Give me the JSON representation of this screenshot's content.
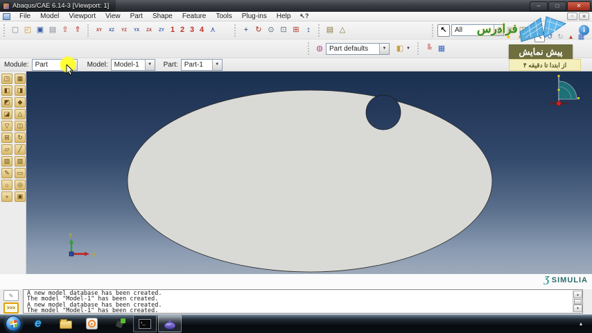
{
  "window": {
    "title": "Abaqus/CAE 6.14-3 [Viewport: 1]",
    "controls": {
      "minimize": "–",
      "maximize": "□",
      "close": "✕"
    },
    "child_controls": {
      "restore": "▫",
      "close": "✕"
    }
  },
  "menubar": {
    "items": [
      "File",
      "Model",
      "Viewport",
      "View",
      "Part",
      "Shape",
      "Feature",
      "Tools",
      "Plug-ins",
      "Help"
    ],
    "context_help": "↖?"
  },
  "toolbar_file": [
    {
      "name": "new-model-icon",
      "g": "▢",
      "tc": "#7a8694"
    },
    {
      "name": "open-database-icon",
      "g": "◰",
      "tc": "#c89020"
    },
    {
      "name": "save-database-icon",
      "g": "▣",
      "tc": "#31589e"
    },
    {
      "name": "print-icon",
      "g": "▤",
      "tc": "#7d8794"
    },
    {
      "name": "import-file-icon",
      "g": "⇧",
      "tc": "#b42d22"
    },
    {
      "name": "export-file-icon",
      "g": "⇑",
      "tc": "#b42d22"
    }
  ],
  "toolbar_views": [
    {
      "name": "view-front-icon",
      "g": "XY",
      "tc": "#b03030"
    },
    {
      "name": "view-back-icon",
      "g": "XZ",
      "tc": "#3050a8"
    },
    {
      "name": "view-top-icon",
      "g": "YZ",
      "tc": "#b03030"
    },
    {
      "name": "view-bottom-icon",
      "g": "YX",
      "tc": "#3050a8"
    },
    {
      "name": "view-left-icon",
      "g": "ZX",
      "tc": "#b03030"
    },
    {
      "name": "view-right-icon",
      "g": "ZY",
      "tc": "#3050a8"
    }
  ],
  "view_numbers": [
    {
      "name": "viewport-1-button",
      "g": "1"
    },
    {
      "name": "viewport-2-button",
      "g": "2"
    },
    {
      "name": "viewport-3-button",
      "g": "3"
    },
    {
      "name": "viewport-4-button",
      "g": "4"
    }
  ],
  "iso_view": {
    "name": "iso-view-icon",
    "g": "⋏",
    "tc": "#3050a8"
  },
  "toolbar_nav": [
    {
      "name": "pan-view-icon",
      "g": "+",
      "tc": "#20407c"
    },
    {
      "name": "rotate-view-icon",
      "g": "↻",
      "tc": "#a03020"
    },
    {
      "name": "magnify-view-icon",
      "g": "⊙",
      "tc": "#5a6a7a"
    },
    {
      "name": "box-zoom-icon",
      "g": "⊡",
      "tc": "#5a6a7a"
    },
    {
      "name": "auto-fit-icon",
      "g": "⊞",
      "tc": "#b43020"
    },
    {
      "name": "cycle-views-icon",
      "g": "↕",
      "tc": "#20407c"
    }
  ],
  "toolbar_render": [
    {
      "name": "render-wireframe-icon",
      "g": "▤",
      "tc": "#8a7440"
    },
    {
      "name": "render-shaded-icon",
      "g": "△",
      "tc": "#8a7440"
    }
  ],
  "selection_toolbar": {
    "cursor_glyph": "↖",
    "value": "All",
    "icons": [
      {
        "name": "selection-disabled-icon",
        "g": "▣",
        "tc": "#b4b4b4"
      },
      {
        "name": "select-group-icon",
        "g": "◫",
        "tc": "#7a6a40"
      },
      {
        "name": "select-box-icon",
        "g": "▭",
        "tc": "#c03030"
      },
      {
        "name": "select-points-icon",
        "g": "◉",
        "tc": "#c07030"
      }
    ]
  },
  "mini_row": [
    {
      "name": "color-code-yellow-icon",
      "g": "●",
      "tc": "#e8c422",
      "sel": "false"
    },
    {
      "name": "color-code-half-icon",
      "g": "◑",
      "tc": "#e8a022",
      "sel": "false"
    },
    {
      "name": "color-code-orange-icon",
      "g": "●",
      "tc": "#e07820",
      "sel": "false"
    },
    {
      "name": "pointer-tool-icon",
      "g": "↖",
      "tc": "#101010",
      "sel": "true"
    },
    {
      "name": "undo-icon",
      "g": "↺",
      "tc": "#3868c0",
      "sel": "false"
    },
    {
      "name": "redo-icon",
      "g": "↻",
      "tc": "#9aa0a8",
      "sel": "false"
    },
    {
      "name": "annotation-icon",
      "g": "▴",
      "tc": "#c04028",
      "sel": "false"
    },
    {
      "name": "table-icon",
      "g": "▦",
      "tc": "#3868c0",
      "sel": "false"
    }
  ],
  "display_toolbar": {
    "palette_glyph": "◍",
    "value": "Part defaults",
    "cube_glyph": "◧",
    "triad_glyph": "╚",
    "grid_glyph": "▦"
  },
  "context_bar": {
    "module_label": "Module:",
    "module_value": "Part",
    "model_label": "Model:",
    "model_value": "Model-1",
    "part_label": "Part:",
    "part_value": "Part-1"
  },
  "toolbox": [
    {
      "name": "create-part-icon",
      "g": "◳"
    },
    {
      "name": "part-manager-icon",
      "g": "▦"
    },
    {
      "name": "create-solid-extrude-icon",
      "g": "◧"
    },
    {
      "name": "create-solid-revolve-icon",
      "g": "◨"
    },
    {
      "name": "create-shell-icon",
      "g": "◩"
    },
    {
      "name": "create-wire-icon",
      "g": "◆"
    },
    {
      "name": "create-cut-icon",
      "g": "◪"
    },
    {
      "name": "create-round-icon",
      "g": "△"
    },
    {
      "name": "create-chamfer-icon",
      "g": "▽"
    },
    {
      "name": "mirror-part-icon",
      "g": "◫"
    },
    {
      "name": "pattern-icon",
      "g": "⊞"
    },
    {
      "name": "regenerate-icon",
      "g": "↻"
    },
    {
      "name": "datum-plane-icon",
      "g": "▱"
    },
    {
      "name": "datum-axis-icon",
      "g": "╱"
    },
    {
      "name": "partition-cell-icon",
      "g": "▨"
    },
    {
      "name": "partition-face-icon",
      "g": "▧"
    },
    {
      "name": "create-sketch-icon",
      "g": "✎"
    },
    {
      "name": "edit-sketch-icon",
      "g": "▭"
    },
    {
      "name": "midsurface-icon",
      "g": "○"
    },
    {
      "name": "repair-geometry-icon",
      "g": "◎"
    },
    {
      "name": "virtual-topology-icon",
      "g": "+"
    },
    {
      "name": "query-icon",
      "g": "▣"
    }
  ],
  "viewport": {
    "triad": {
      "x": "X",
      "y": "Y"
    }
  },
  "overlay": {
    "title": "پیش نمایش",
    "subtitle": "از ابتدا تا دقیقه ۴"
  },
  "watermark": {
    "text": "فرادرس"
  },
  "branding": {
    "swirl": "Ʒ",
    "text": "SIMULIA"
  },
  "message_area": {
    "tabs": [
      {
        "name": "message-log-icon",
        "g": "✎"
      },
      {
        "name": "command-line-icon",
        "g": ">>>"
      }
    ],
    "lines": [
      "A new model database has been created.",
      "The model \"Model-1\" has been created.",
      "A new model database has been created.",
      "The model \"Model-1\" has been created."
    ]
  },
  "taskbar": {
    "tray_arrow": "▴"
  },
  "colors": {
    "viewport_top": "#1b3150",
    "viewport_bottom": "#9daaba",
    "part_fill": "#d9d9d6",
    "overlay_dark": "#6e6e3e",
    "overlay_light": "#f4efbd",
    "close_button": "#9c2818",
    "highlight": "#ffff28"
  }
}
